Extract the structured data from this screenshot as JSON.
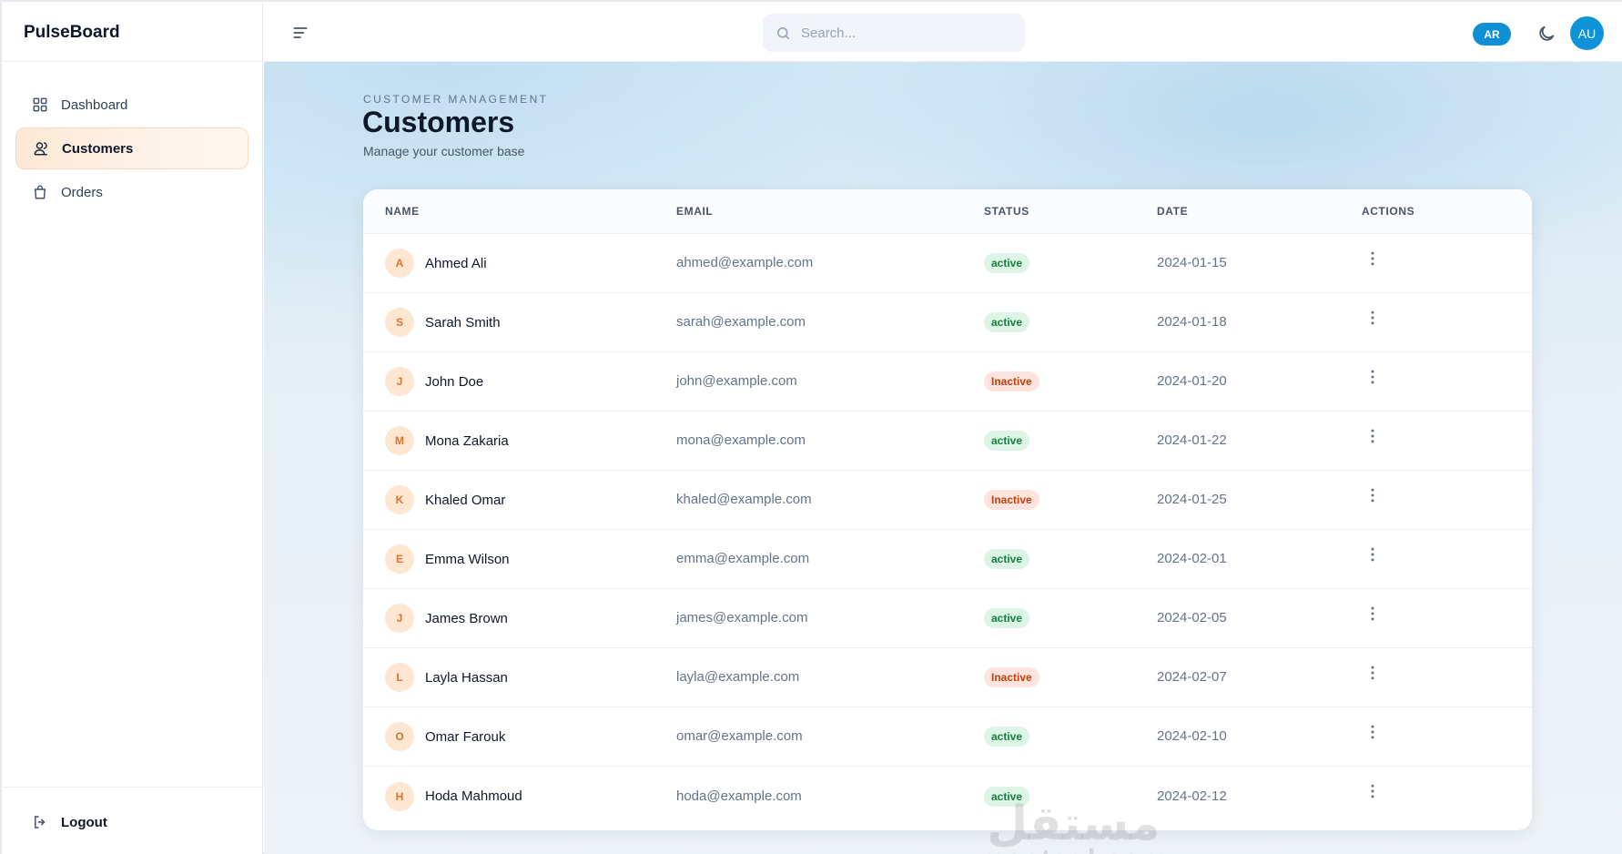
{
  "app": {
    "name": "PulseBoard"
  },
  "sidebar": {
    "items": [
      {
        "label": "Dashboard",
        "icon": "grid-icon",
        "active": false
      },
      {
        "label": "Customers",
        "icon": "users-icon",
        "active": true
      },
      {
        "label": "Orders",
        "icon": "shopping-bag-icon",
        "active": false
      }
    ],
    "logout_label": "Logout"
  },
  "header": {
    "search_placeholder": "Search...",
    "lang_label": "AR",
    "avatar_initials": "AU"
  },
  "page": {
    "eyebrow": "CUSTOMER MANAGEMENT",
    "title": "Customers",
    "subtitle": "Manage your customer base"
  },
  "table": {
    "columns": [
      "NAME",
      "EMAIL",
      "STATUS",
      "DATE",
      "ACTIONS"
    ],
    "rows": [
      {
        "initial": "A",
        "name": "Ahmed Ali",
        "email": "ahmed@example.com",
        "status": "active",
        "date": "2024-01-15"
      },
      {
        "initial": "S",
        "name": "Sarah Smith",
        "email": "sarah@example.com",
        "status": "active",
        "date": "2024-01-18"
      },
      {
        "initial": "J",
        "name": "John Doe",
        "email": "john@example.com",
        "status": "inactive",
        "date": "2024-01-20"
      },
      {
        "initial": "M",
        "name": "Mona Zakaria",
        "email": "mona@example.com",
        "status": "active",
        "date": "2024-01-22"
      },
      {
        "initial": "K",
        "name": "Khaled Omar",
        "email": "khaled@example.com",
        "status": "inactive",
        "date": "2024-01-25"
      },
      {
        "initial": "E",
        "name": "Emma Wilson",
        "email": "emma@example.com",
        "status": "active",
        "date": "2024-02-01"
      },
      {
        "initial": "J",
        "name": "James Brown",
        "email": "james@example.com",
        "status": "active",
        "date": "2024-02-05"
      },
      {
        "initial": "L",
        "name": "Layla Hassan",
        "email": "layla@example.com",
        "status": "inactive",
        "date": "2024-02-07"
      },
      {
        "initial": "O",
        "name": "Omar Farouk",
        "email": "omar@example.com",
        "status": "active",
        "date": "2024-02-10"
      },
      {
        "initial": "H",
        "name": "Hoda Mahmoud",
        "email": "hoda@example.com",
        "status": "active",
        "date": "2024-02-12"
      }
    ]
  },
  "watermark": {
    "arabic": "مستقل",
    "latin": "mostaql.com"
  },
  "colors": {
    "accent": "#1092d9",
    "active_badge_bg": "#dcf5e6",
    "active_badge_text": "#15803d",
    "inactive_badge_bg": "#fde4df",
    "inactive_badge_text": "#c2410c",
    "avatar_bg": "#fde7d3",
    "avatar_text": "#e0732b"
  }
}
